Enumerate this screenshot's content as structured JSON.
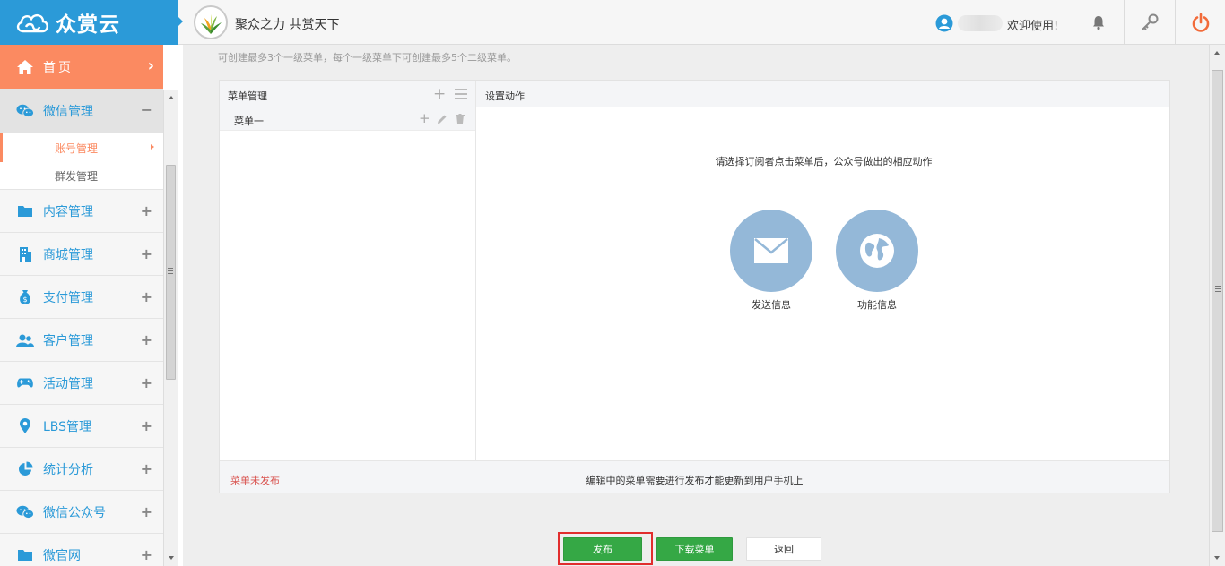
{
  "header": {
    "logo_text": "众赏云",
    "slogan": "聚众之力 共赏天下",
    "welcome": "欢迎使用!",
    "icons": [
      "bell-icon",
      "key-icon",
      "power-icon"
    ],
    "colors": {
      "logo_bg": "#2b9ad8",
      "power": "#f26b3a"
    }
  },
  "sidebar": {
    "home_label": "首页",
    "items": [
      {
        "label": "微信管理",
        "icon": "wechat-icon",
        "expanded": true,
        "children": [
          {
            "label": "账号管理",
            "active": true
          },
          {
            "label": "群发管理"
          }
        ]
      },
      {
        "label": "内容管理",
        "icon": "folder-icon"
      },
      {
        "label": "商城管理",
        "icon": "building-icon"
      },
      {
        "label": "支付管理",
        "icon": "money-bag-icon"
      },
      {
        "label": "客户管理",
        "icon": "users-icon"
      },
      {
        "label": "活动管理",
        "icon": "gamepad-icon"
      },
      {
        "label": "LBS管理",
        "icon": "map-pin-icon"
      },
      {
        "label": "统计分析",
        "icon": "pie-chart-icon"
      },
      {
        "label": "微信公众号",
        "icon": "wechat-icon"
      },
      {
        "label": "微官网",
        "icon": "folder-icon"
      }
    ]
  },
  "main": {
    "hint": "可创建最多3个一级菜单，每个一级菜单下可创建最多5个二级菜单。",
    "menu_panel_title": "菜单管理",
    "menus": [
      {
        "name": "菜单一"
      }
    ],
    "action_panel_title": "设置动作",
    "action_prompt": "请选择订阅者点击菜单后，公众号做出的相应动作",
    "actions": [
      {
        "label": "发送信息",
        "icon": "envelope-icon"
      },
      {
        "label": "功能信息",
        "icon": "globe-icon"
      }
    ],
    "status_label": "菜单未发布",
    "status_note": "编辑中的菜单需要进行发布才能更新到用户手机上",
    "buttons": {
      "publish": "发布",
      "download": "下载菜单",
      "back": "返回"
    }
  }
}
